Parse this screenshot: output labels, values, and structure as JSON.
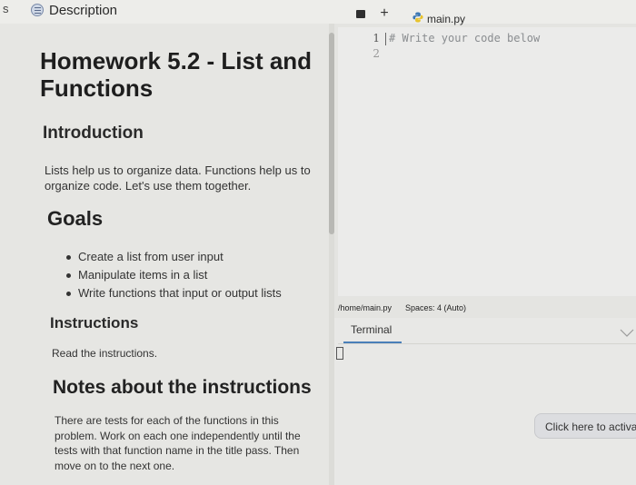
{
  "edge_letter": "s",
  "description_tab": {
    "label": "Description"
  },
  "description": {
    "title": "Homework 5.2 - List and Functions",
    "intro_heading": "Introduction",
    "intro_text": "Lists help us to organize data. Functions help us to organize code. Let's use them together.",
    "goals_heading": "Goals",
    "goals": [
      "Create a list from user input",
      "Manipulate items in a list",
      "Write functions that input or output lists"
    ],
    "instructions_heading": "Instructions",
    "instructions_text": "Read the instructions.",
    "notes_heading": "Notes about the instructions",
    "notes_text": "There are tests for each of the functions in this problem. Work on each one independently until the tests with that function name in the title pass. Then move on to the next one."
  },
  "editor": {
    "add_tab_label": "+",
    "file_tab": "main.py",
    "line_numbers": [
      "1",
      "2"
    ],
    "code_line_1": "# Write your code below"
  },
  "status_bar": {
    "path": "/home/main.py",
    "spaces": "Spaces: 4 (Auto)"
  },
  "terminal": {
    "tab_label": "Terminal"
  },
  "activate_button": {
    "label": "Click here to activate"
  },
  "colors": {
    "accent": "#4a7fb8",
    "background": "#e4e4e1"
  }
}
